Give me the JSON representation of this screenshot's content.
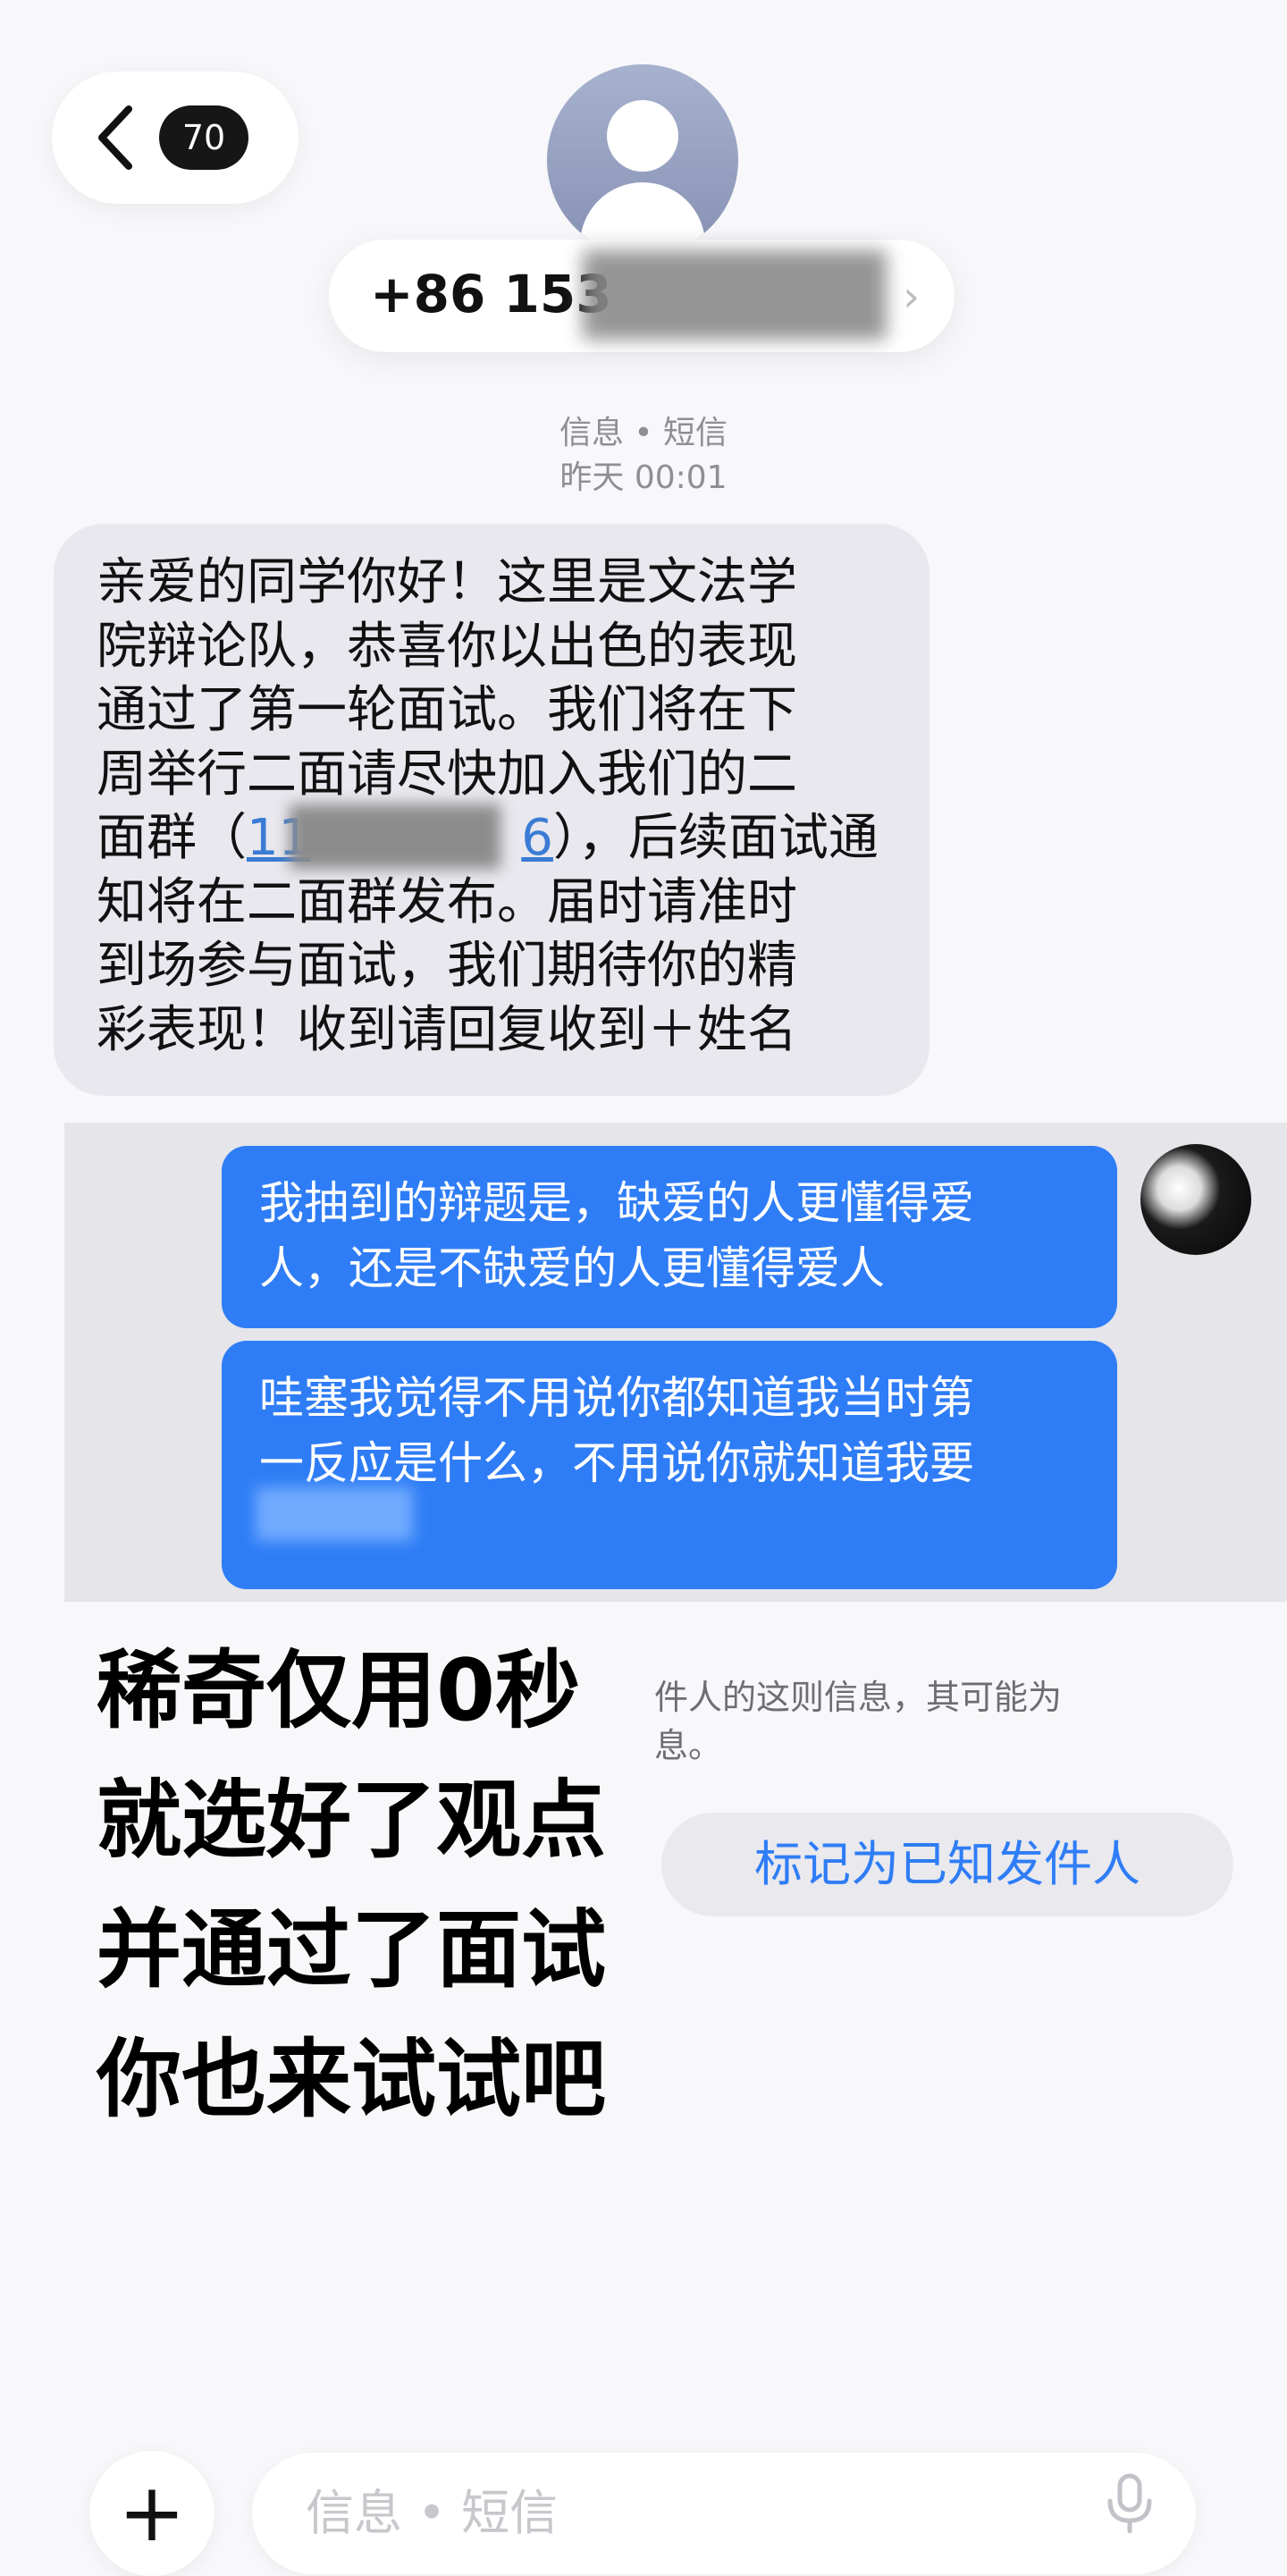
{
  "header": {
    "unread_count": "70",
    "phone_number": "+86 153",
    "service": "信息 • 短信",
    "timestamp": "昨天 00:01"
  },
  "incoming_message": {
    "text_before_link": "亲爱的同学你好！这里是文法学\n院辩论队，恭喜你以出色的表现\n通过了第一轮面试。我们将在下\n周举行二面请尽快加入我们的二\n面群（",
    "link_start": "11",
    "link_end": "6",
    "text_after_link": "），后续面试通\n知将在二面群发布。届时请准时\n到场参与面试，我们期待你的精\n彩表现！收到请回复收到＋姓名"
  },
  "overlay_chat": {
    "message_1": "我抽到的辩题是，缺爱的人更懂得爱\n人，还是不缺爱的人更懂得爱人",
    "message_2": "哇塞我觉得不用说你都知道我当时第\n一反应是什么，不用说你就知道我要"
  },
  "partial_info": "件人的这则信息，其可能为\n息。",
  "known_sender_button": "标记为已知发件人",
  "caption_lines": [
    "稀奇仅用0秒",
    "就选好了观点",
    "并通过了面试",
    "你也来试试吧"
  ],
  "input": {
    "placeholder": "信息 • 短信"
  }
}
